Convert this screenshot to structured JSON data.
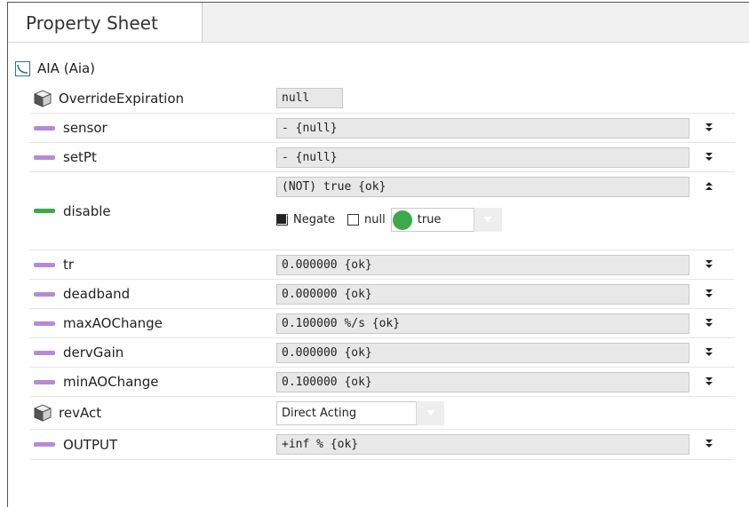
{
  "tab": {
    "title": "Property Sheet"
  },
  "root": {
    "label": "AIA  (Aia)",
    "icon": "chart-box-icon"
  },
  "rows": [
    {
      "name": "OverrideExpiration",
      "value": "null",
      "icon": "box-icon"
    },
    {
      "name": "sensor",
      "value": "- {null}",
      "icon": "slot-bar-icon"
    },
    {
      "name": "setPt",
      "value": "- {null}",
      "icon": "slot-bar-icon"
    },
    {
      "name": "disable",
      "value": "(NOT) true {ok}",
      "icon": "slot-bar-icon",
      "editor": {
        "negate_label": "Negate",
        "negate_checked": true,
        "null_label": "null",
        "null_checked": false,
        "value_label": "true"
      }
    },
    {
      "name": "tr",
      "value": "0.000000 {ok}",
      "icon": "slot-bar-icon"
    },
    {
      "name": "deadband",
      "value": "0.000000 {ok}",
      "icon": "slot-bar-icon"
    },
    {
      "name": "maxAOChange",
      "value": "0.100000 %/s {ok}",
      "icon": "slot-bar-icon"
    },
    {
      "name": "dervGain",
      "value": "0.000000 {ok}",
      "icon": "slot-bar-icon"
    },
    {
      "name": "minAOChange",
      "value": "0.100000 {ok}",
      "icon": "slot-bar-icon"
    },
    {
      "name": "revAct",
      "value": "Direct Acting",
      "icon": "box-icon"
    },
    {
      "name": "OUTPUT",
      "value": "+inf % {ok}",
      "icon": "slot-bar-icon"
    }
  ],
  "colors": {
    "slot_purple": "#b48bd8",
    "slot_green": "#3daa4a",
    "field_bg": "#e8e8e8"
  }
}
